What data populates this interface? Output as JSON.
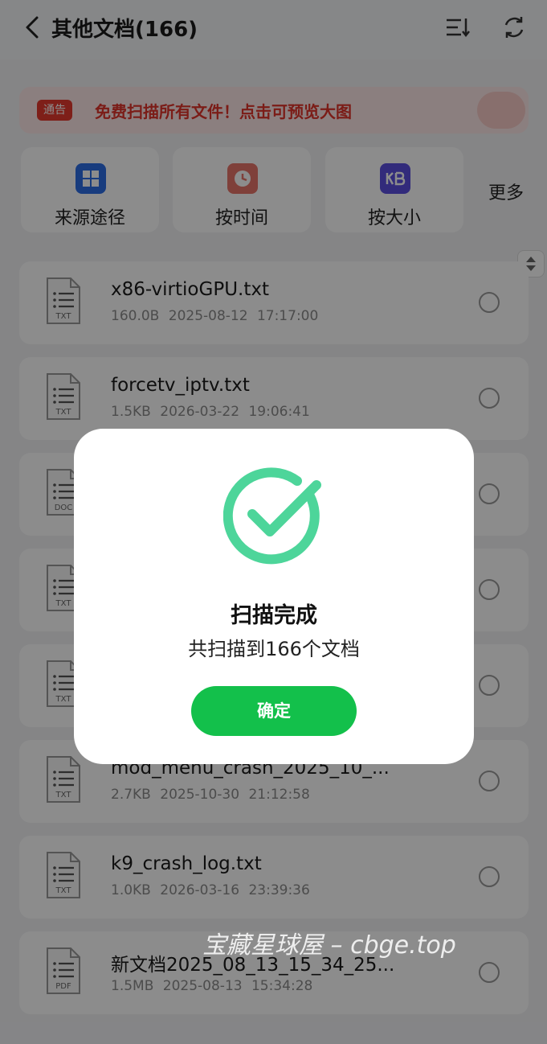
{
  "header": {
    "title": "其他文档(166)"
  },
  "notice": {
    "badge": "通告",
    "text": "免费扫描所有文件！点击可预览大图"
  },
  "filters": [
    {
      "label": "来源途径",
      "icon": "grid-icon",
      "color": "#2d6ee6"
    },
    {
      "label": "按时间",
      "icon": "clock-icon",
      "color": "#e8766b"
    },
    {
      "label": "按大小",
      "icon": "kb-icon",
      "color": "#5b4fe0"
    }
  ],
  "more_label": "更多",
  "files": [
    {
      "name": "x86-virtioGPU.txt",
      "size": "160.0B",
      "date": "2025-08-12 17:17:00",
      "type": "TXT"
    },
    {
      "name": "forcetv_iptv.txt",
      "size": "1.5KB",
      "date": "2026-03-22 19:06:41",
      "type": "TXT"
    },
    {
      "name": "",
      "size": "",
      "date": "",
      "type": "DOC"
    },
    {
      "name": "",
      "size": "",
      "date": "",
      "type": "TXT"
    },
    {
      "name": "",
      "size": "",
      "date": "",
      "type": "TXT"
    },
    {
      "name": "mod_menu_crash_2025_10_...",
      "size": "2.7KB",
      "date": "2025-10-30 21:12:58",
      "type": "TXT"
    },
    {
      "name": "k9_crash_log.txt",
      "size": "1.0KB",
      "date": "2026-03-16 23:39:36",
      "type": "TXT"
    },
    {
      "name": "新文档2025_08_13_15_34_25...",
      "size": "1.5MB",
      "date": "2025-08-13 15:34:28",
      "type": "PDF"
    }
  ],
  "dialog": {
    "title": "扫描完成",
    "subtitle": "共扫描到166个文档",
    "confirm_label": "确定"
  },
  "watermark": "宝藏星球屋 – cbge.top",
  "colors": {
    "accent": "#13c04b",
    "notice": "#e0332a"
  }
}
